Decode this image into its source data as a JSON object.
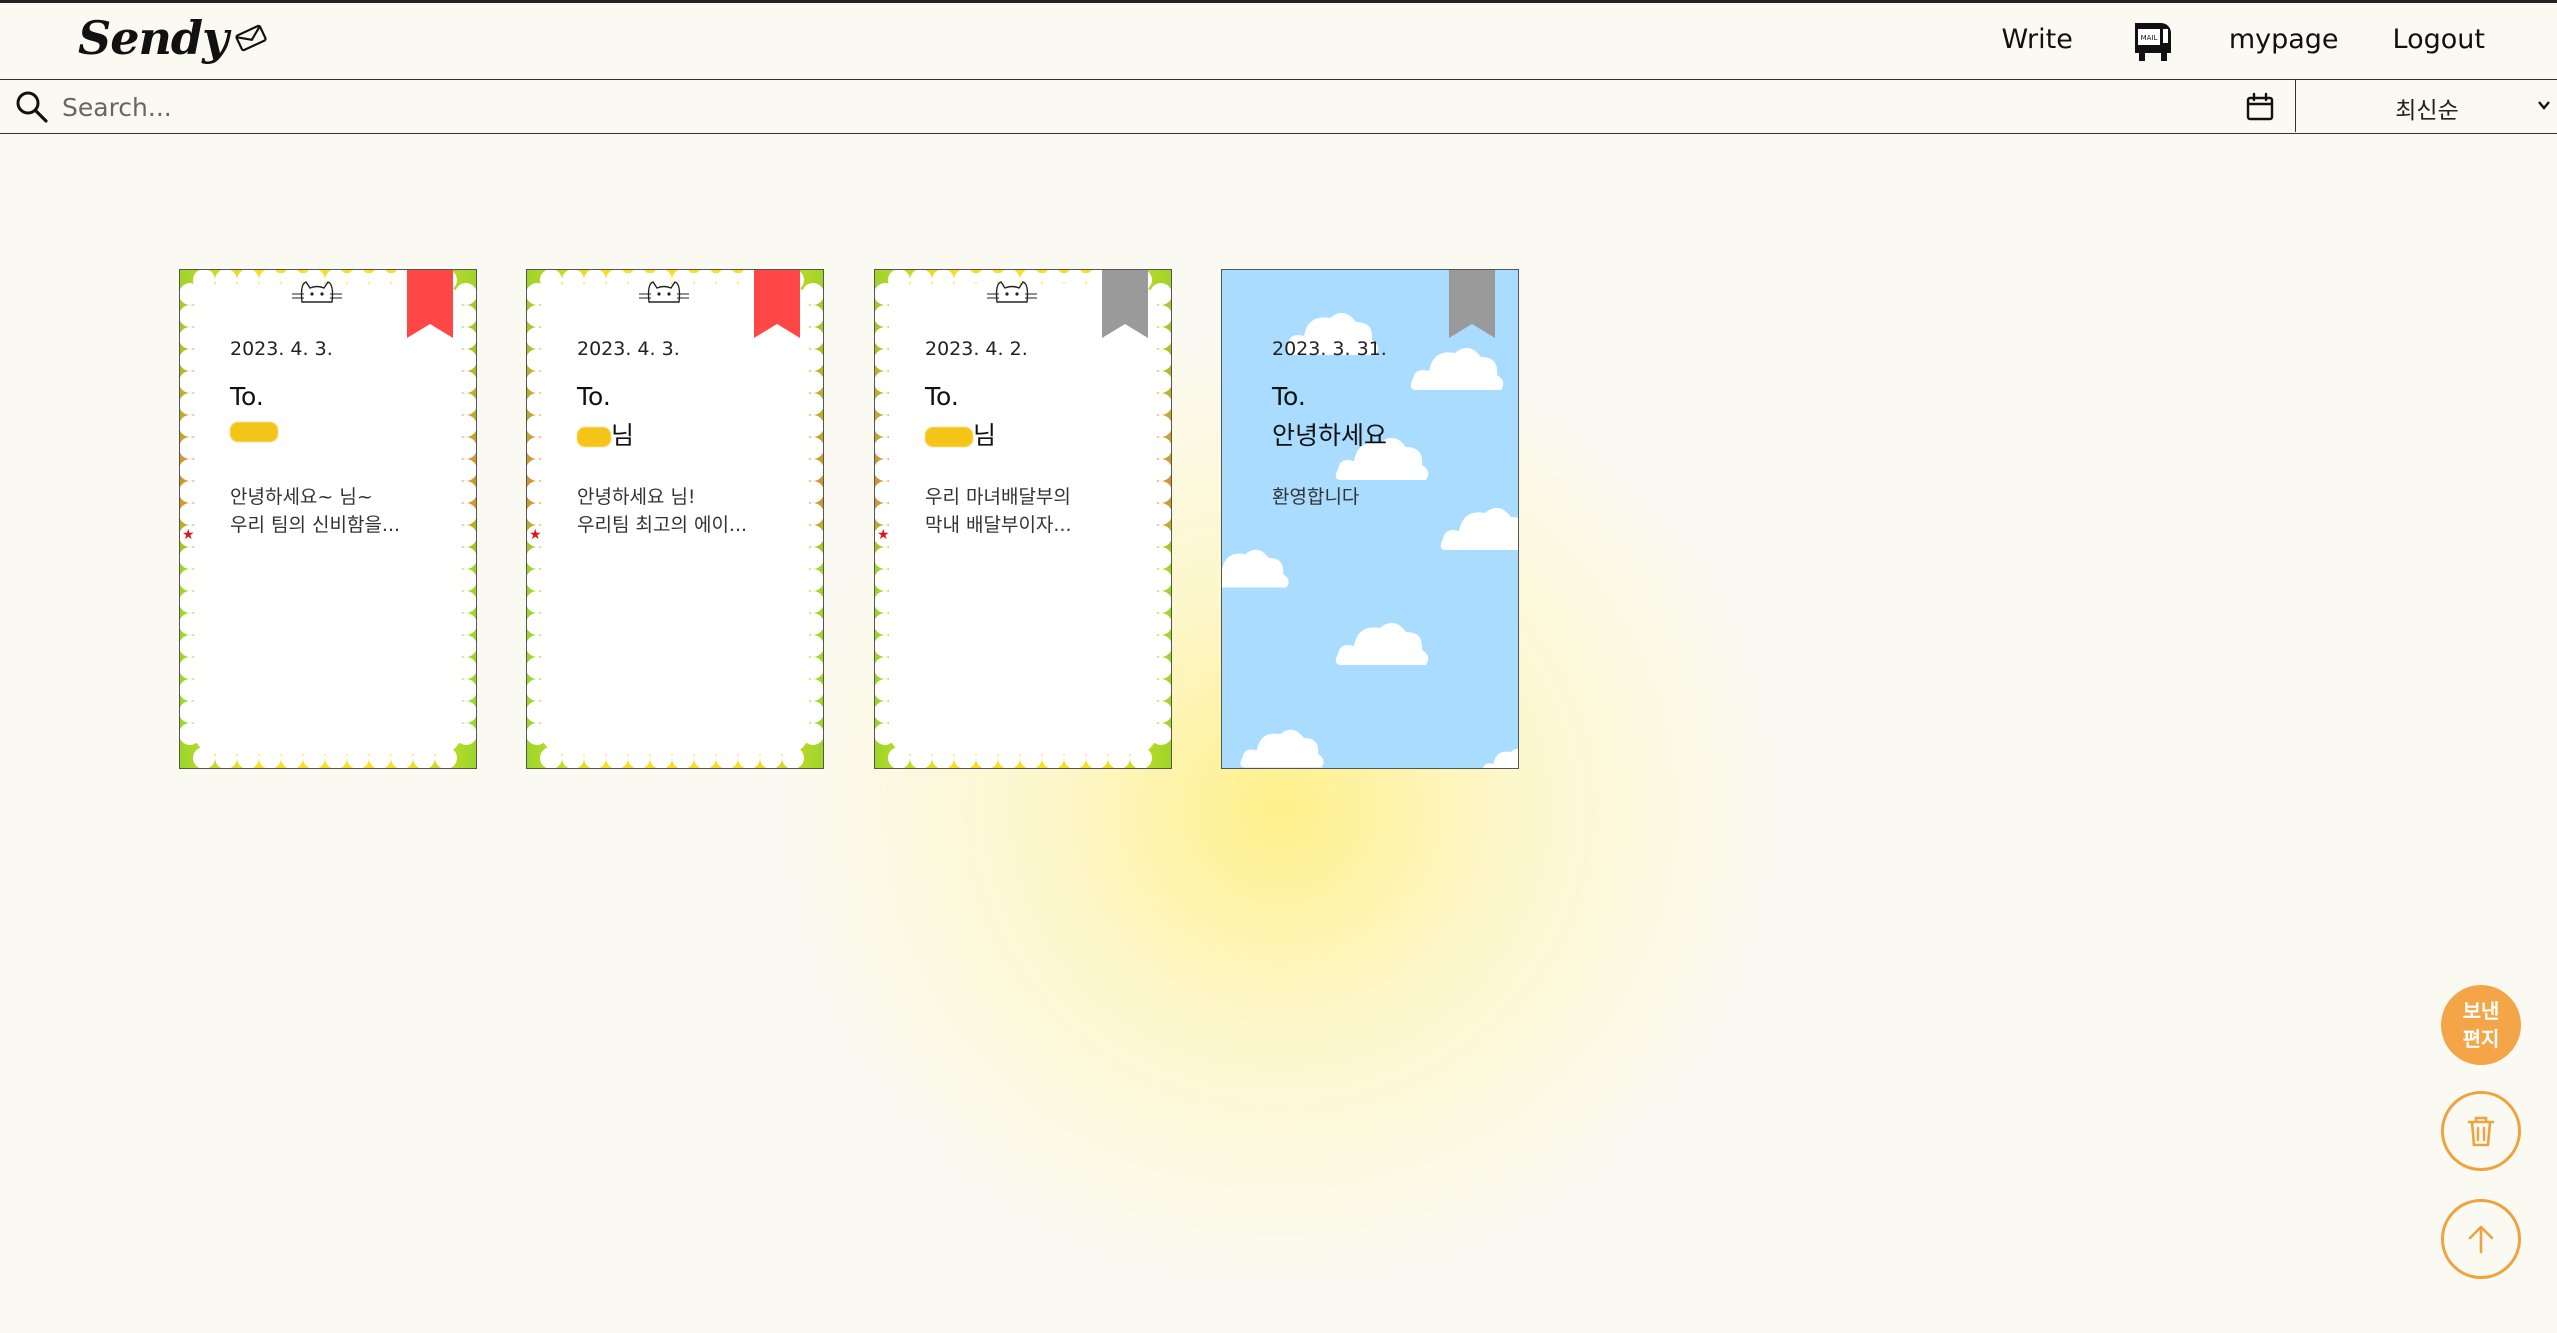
{
  "header": {
    "logo_text": "Sendy",
    "nav": {
      "write_label": "Write",
      "mailbox_label": "MAIL",
      "mypage_label": "mypage",
      "logout_label": "Logout"
    }
  },
  "search": {
    "placeholder": "Search...",
    "value": "",
    "sort_selected": "최신순"
  },
  "letters": [
    {
      "date": "2023. 4. 3.",
      "to": "To.",
      "name_suffix": "",
      "body": "안녕하세요~ 님~\n우리 팀의 신비함을...",
      "style": "frame",
      "bookmarked": true
    },
    {
      "date": "2023. 4. 3.",
      "to": "To.",
      "name_suffix": "님",
      "body": "안녕하세요 님!\n우리팀 최고의 에이...",
      "style": "frame",
      "bookmarked": true
    },
    {
      "date": "2023. 4. 2.",
      "to": "To.",
      "name_suffix": "님",
      "body": "우리 마녀배달부의\n막내 배달부이자...",
      "style": "frame",
      "bookmarked": false
    },
    {
      "date": "2023. 3. 31.",
      "to": "To.",
      "name": "안녕하세요",
      "body": "환영합니다",
      "style": "sky",
      "bookmarked": false
    }
  ],
  "floating": {
    "sent_label_line1": "보낸",
    "sent_label_line2": "편지"
  },
  "colors": {
    "background": "#fbfaf2",
    "bookmark_active": "#ff4747",
    "bookmark_inactive": "#9a9a9a",
    "accent_orange": "#f3a548",
    "sky": "#a9dcff"
  },
  "icons": [
    "envelope-icon",
    "mailbox-icon",
    "search-icon",
    "calendar-icon",
    "chevron-down-icon",
    "bookmark-icon",
    "cat-icon",
    "trash-icon",
    "arrow-up-icon",
    "cloud-icon"
  ]
}
